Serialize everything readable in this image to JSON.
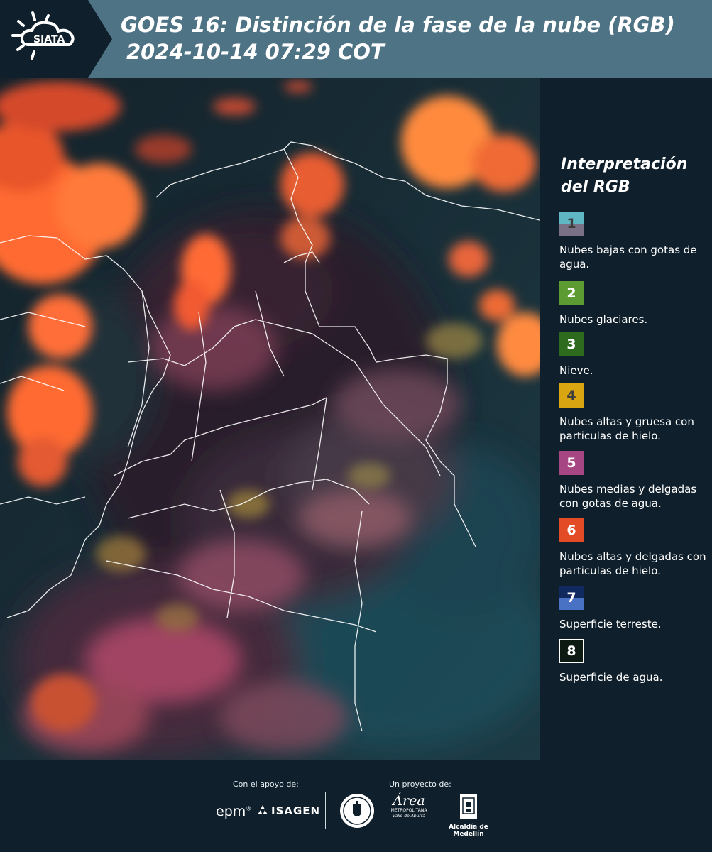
{
  "header": {
    "logo_text": "SIATA",
    "title_line1": "GOES 16: Distinción de la fase de la nube (RGB)",
    "title_line2": "2024-10-14 07:29 COT",
    "background_color": "#4e7384"
  },
  "map": {
    "description_icon": "satellite-rgb-map"
  },
  "legend": {
    "title": "Interpretación del RGB",
    "items": [
      {
        "number": "1",
        "label": "Nubes bajas con gotas de agua.",
        "color_top": "#5fb7c3",
        "color_bottom": "#7b7186"
      },
      {
        "number": "2",
        "label": "Nubes glaciares.",
        "color_top": "#5c9b32",
        "color_bottom": "#5c9b32"
      },
      {
        "number": "3",
        "label": "Nieve.",
        "color_top": "#2e6b1e",
        "color_bottom": "#2e6b1e"
      },
      {
        "number": "4",
        "label": "Nubes altas y gruesa con particulas de hielo.",
        "color_top": "#d9a612",
        "color_bottom": "#d9a612"
      },
      {
        "number": "5",
        "label": "Nubes medias y delgadas con gotas de agua.",
        "color_top": "#a64783",
        "color_bottom": "#a64783"
      },
      {
        "number": "6",
        "label": "Nubes altas y delgadas con particulas de hielo.",
        "color_top": "#e34a26",
        "color_bottom": "#e34a26"
      },
      {
        "number": "7",
        "label": "Superficie terreste.",
        "color_top": "#10295f",
        "color_bottom": "#4a72c4"
      },
      {
        "number": "8",
        "label": "Superficie de agua.",
        "color_top": "#0c1a12",
        "color_bottom": "#0c1a12"
      }
    ]
  },
  "footer": {
    "support_label": "Con el apoyo de:",
    "project_label": "Un proyecto de:",
    "epm": "epm",
    "isagen": "ISAGEN",
    "area_line1": "Área",
    "area_line2": "METROPOLITANA",
    "area_line3": "Valle de Aburrá",
    "alcaldia": "Alcaldía de Medellín"
  }
}
